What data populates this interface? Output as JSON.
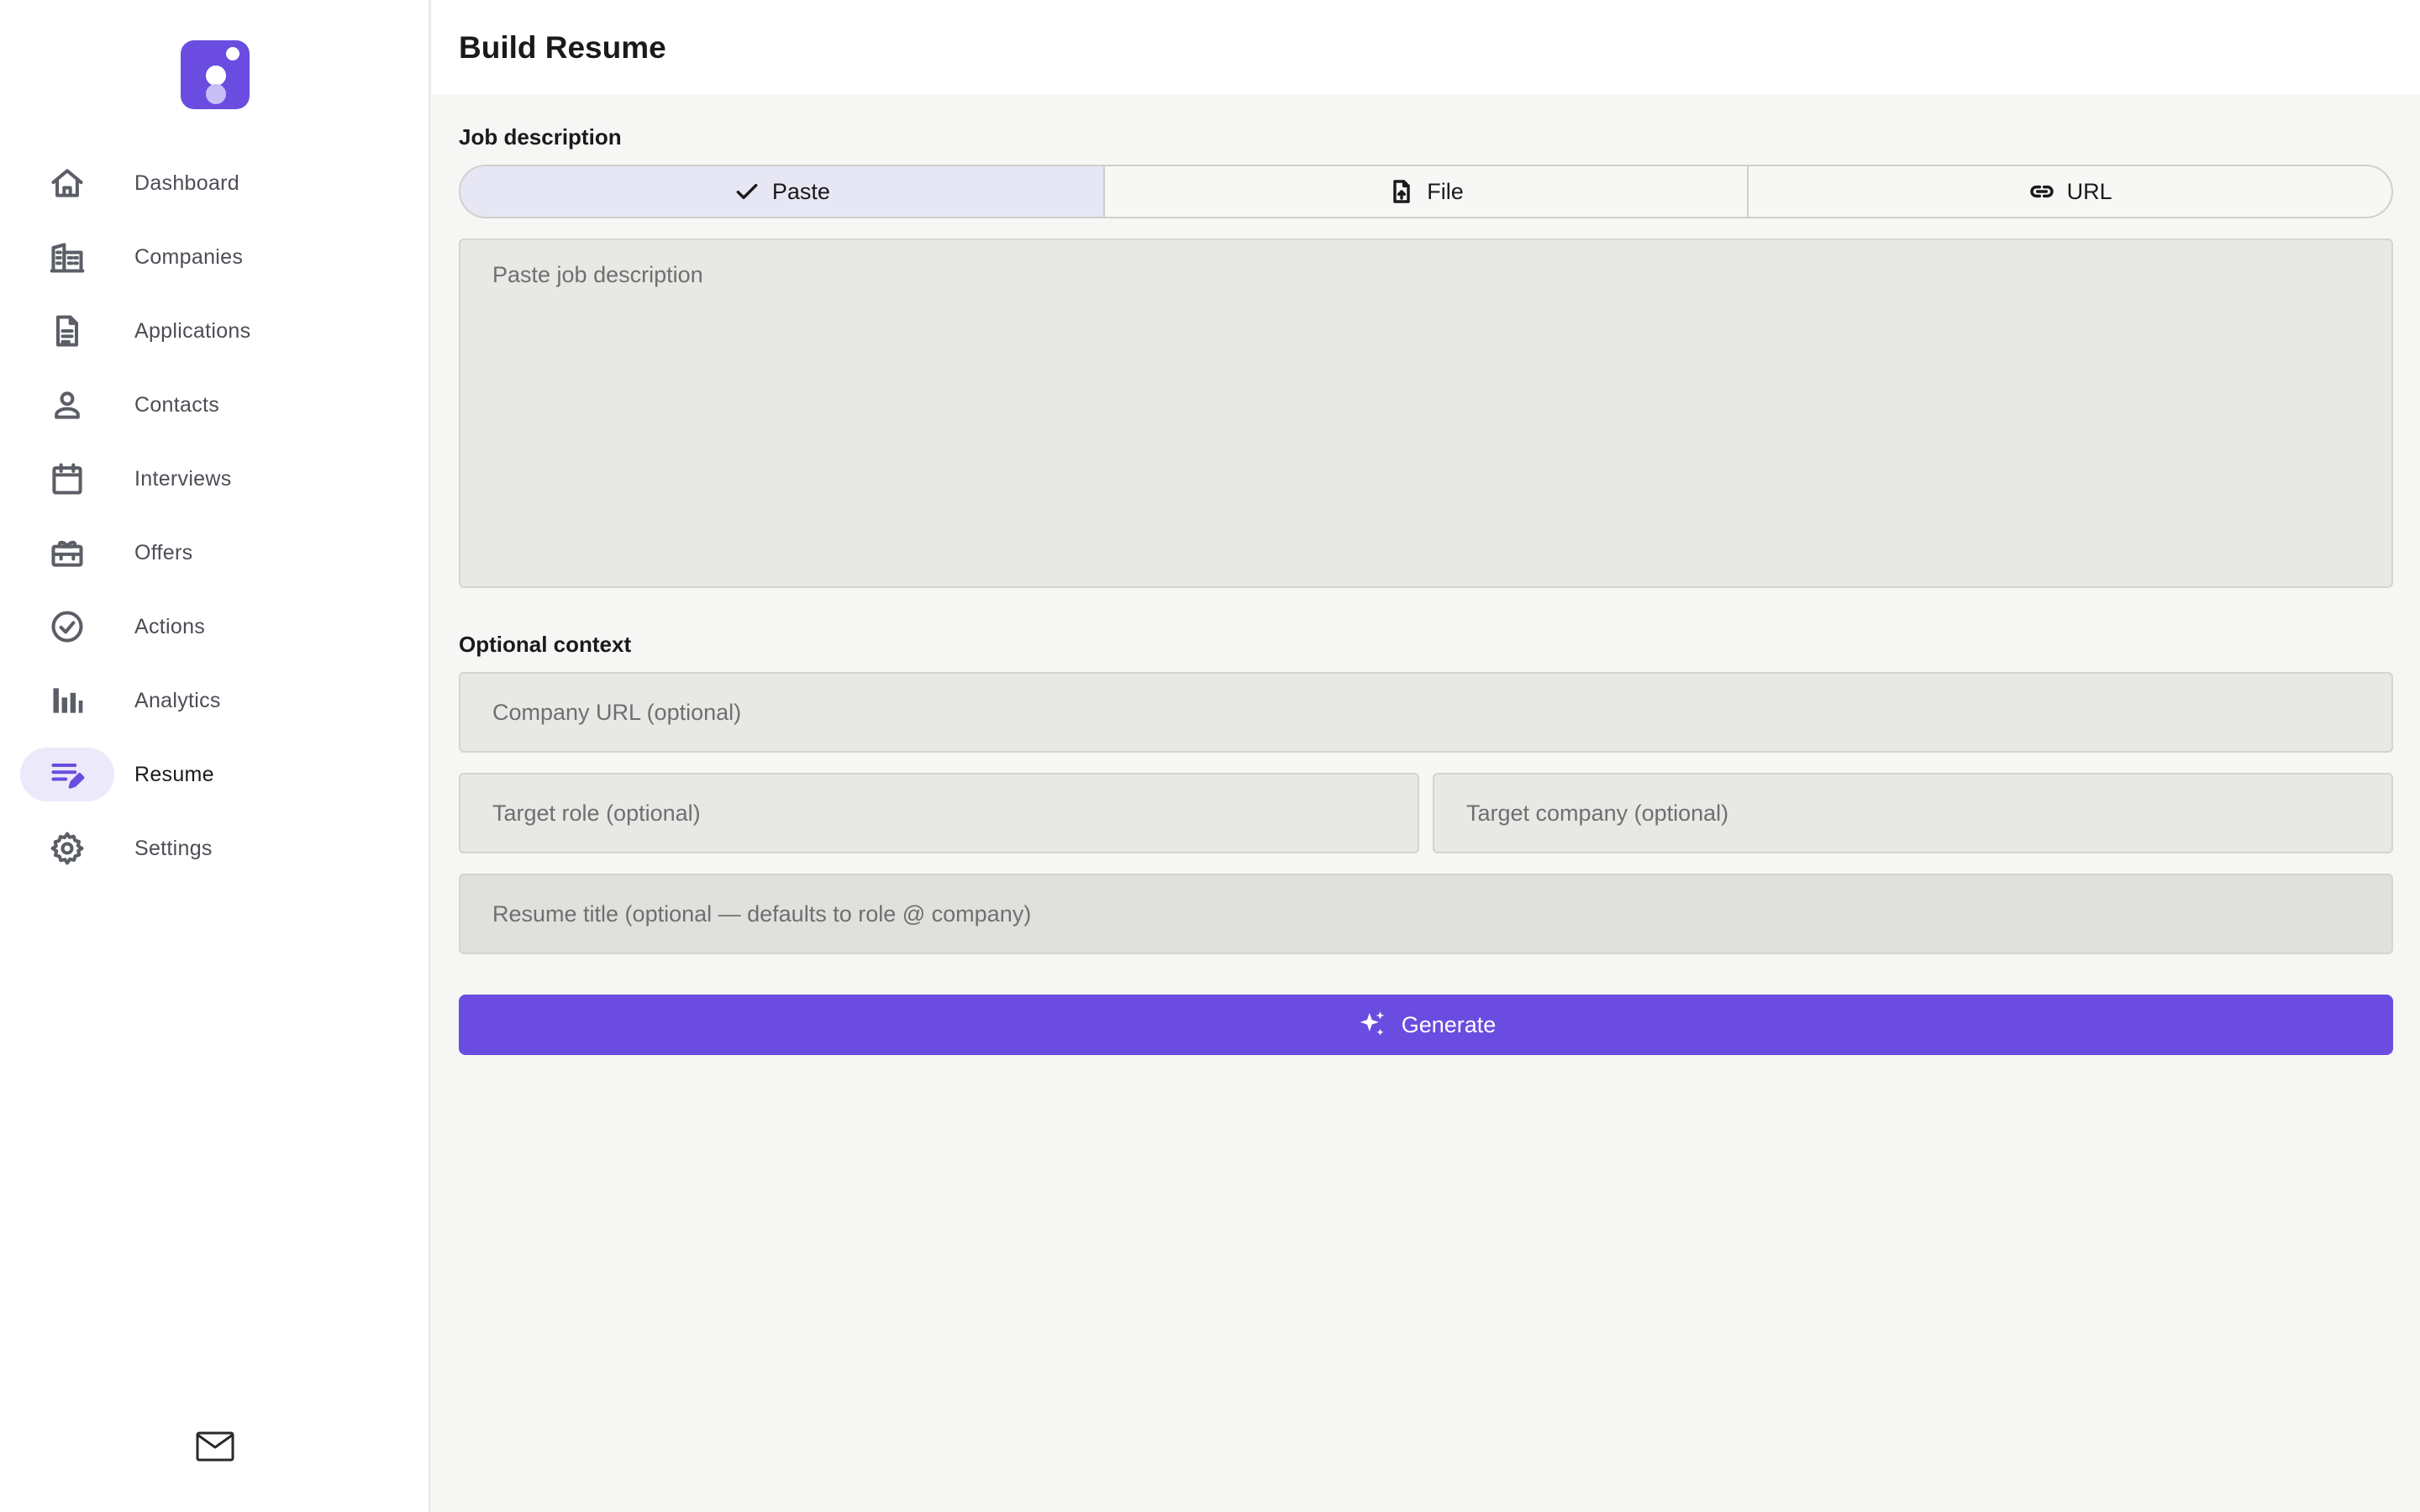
{
  "colors": {
    "accent": "#6a4ce0",
    "accent_soft": "#ece9fb",
    "sidebar_bg": "#ffffff",
    "main_bg": "#f6f6f4"
  },
  "sidebar": {
    "items": [
      {
        "label": "Dashboard",
        "icon": "home-icon",
        "active": false
      },
      {
        "label": "Companies",
        "icon": "building-icon",
        "active": false
      },
      {
        "label": "Applications",
        "icon": "document-icon",
        "active": false
      },
      {
        "label": "Contacts",
        "icon": "person-icon",
        "active": false
      },
      {
        "label": "Interviews",
        "icon": "calendar-icon",
        "active": false
      },
      {
        "label": "Offers",
        "icon": "gift-icon",
        "active": false
      },
      {
        "label": "Actions",
        "icon": "check-circle-icon",
        "active": false
      },
      {
        "label": "Analytics",
        "icon": "bar-chart-icon",
        "active": false
      },
      {
        "label": "Resume",
        "icon": "edit-note-icon",
        "active": true
      },
      {
        "label": "Settings",
        "icon": "gear-icon",
        "active": false
      }
    ],
    "footer_icon": "mail-icon"
  },
  "header": {
    "title": "Build Resume"
  },
  "job_description": {
    "label": "Job description",
    "tabs": [
      {
        "label": "Paste",
        "icon": "check-icon",
        "active": true
      },
      {
        "label": "File",
        "icon": "file-upload-icon",
        "active": false
      },
      {
        "label": "URL",
        "icon": "link-icon",
        "active": false
      }
    ],
    "placeholder": "Paste job description",
    "value": ""
  },
  "optional_context": {
    "label": "Optional context",
    "company_url_placeholder": "Company URL (optional)",
    "target_role_placeholder": "Target role (optional)",
    "target_company_placeholder": "Target company (optional)",
    "resume_title_placeholder": "Resume title (optional — defaults to role @ company)"
  },
  "generate_button": {
    "label": "Generate",
    "icon": "sparkle-icon"
  }
}
